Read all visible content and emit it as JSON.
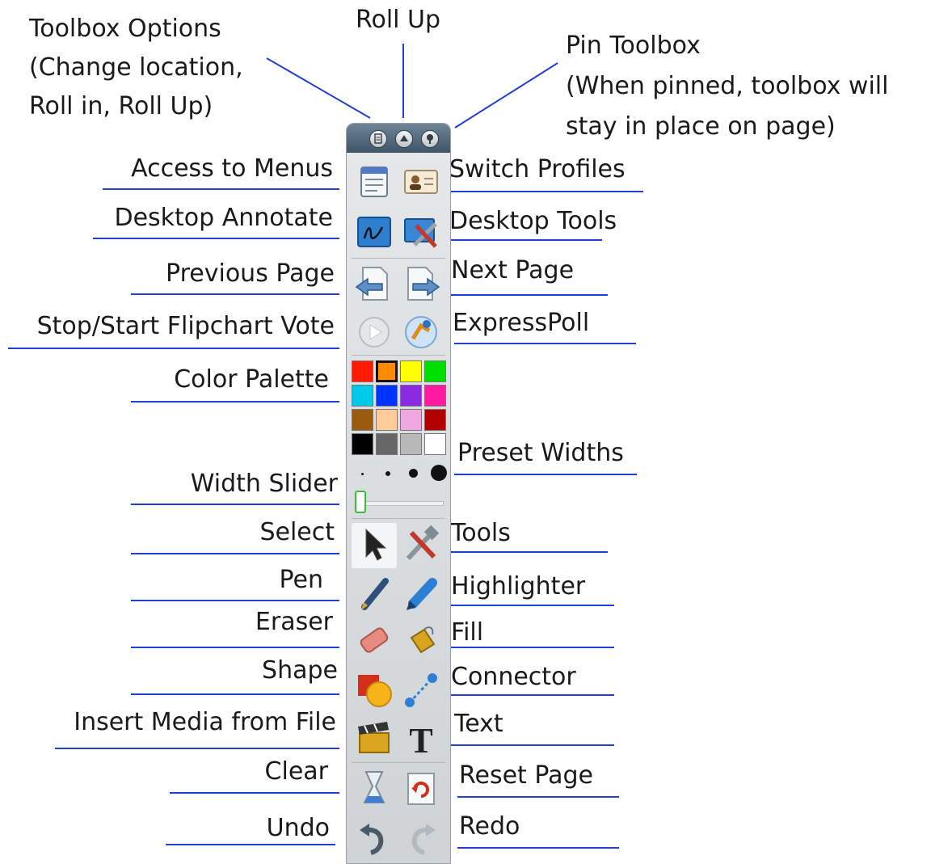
{
  "annotations": {
    "toolbox_options": [
      "Toolbox Options",
      "(Change location,",
      "Roll in, Roll Up)"
    ],
    "roll_up": "Roll Up",
    "pin_toolbox": [
      "Pin Toolbox",
      "(When pinned, toolbox will",
      "stay in place on page)"
    ]
  },
  "labels": {
    "left": {
      "access_menus": "Access to Menus",
      "desktop_annotate": "Desktop Annotate",
      "previous_page": "Previous Page",
      "flipchart_vote": "Stop/Start Flipchart Vote",
      "color_palette": "Color Palette",
      "width_slider": "Width Slider",
      "select": "Select",
      "pen": "Pen",
      "eraser": "Eraser",
      "shape": "Shape",
      "insert_media": "Insert Media from File",
      "clear": "Clear",
      "undo": "Undo"
    },
    "right": {
      "switch_profiles": "Switch Profiles",
      "desktop_tools": "Desktop Tools",
      "next_page": "Next Page",
      "express_poll": "ExpressPoll",
      "preset_widths": "Preset Widths",
      "tools": "Tools",
      "highlighter": "Highlighter",
      "fill": "Fill",
      "connector": "Connector",
      "text": "Text",
      "reset_page": "Reset Page",
      "redo": "Redo"
    }
  },
  "colors": {
    "leader_line": "#1f3fd6",
    "palette": [
      "#ff1a00",
      "#ff8c00",
      "#ffff00",
      "#00e000",
      "#00c8e8",
      "#0033ff",
      "#8a2be2",
      "#ff1a9e",
      "#9a5a10",
      "#ffcc99",
      "#f0a8e0",
      "#b00000",
      "#000000",
      "#666666",
      "#b8b8b8",
      "#ffffff"
    ],
    "selected_swatch": 1
  }
}
